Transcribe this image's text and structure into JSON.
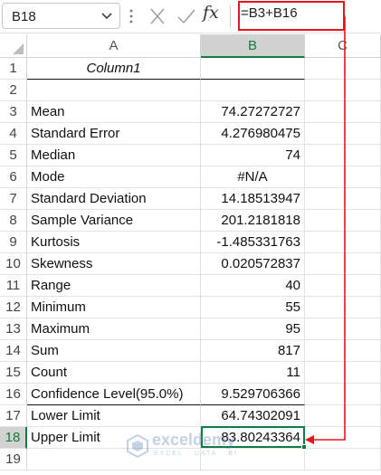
{
  "formula_bar": {
    "name_box": "B18",
    "fx_label": "fx",
    "formula": "=B3+B16"
  },
  "columns": [
    "A",
    "B",
    "C"
  ],
  "rows": [
    {
      "num": "1",
      "a": "",
      "b": "",
      "a_header": "Column1"
    },
    {
      "num": "2",
      "a": "",
      "b": ""
    },
    {
      "num": "3",
      "a": "Mean",
      "b": "74.27272727"
    },
    {
      "num": "4",
      "a": "Standard Error",
      "b": "4.276980475"
    },
    {
      "num": "5",
      "a": "Median",
      "b": "74"
    },
    {
      "num": "6",
      "a": "Mode",
      "b": "#N/A"
    },
    {
      "num": "7",
      "a": "Standard Deviation",
      "b": "14.18513947"
    },
    {
      "num": "8",
      "a": "Sample Variance",
      "b": "201.2181818"
    },
    {
      "num": "9",
      "a": "Kurtosis",
      "b": "-1.485331763"
    },
    {
      "num": "10",
      "a": "Skewness",
      "b": "0.020572837"
    },
    {
      "num": "11",
      "a": "Range",
      "b": "40"
    },
    {
      "num": "12",
      "a": "Minimum",
      "b": "55"
    },
    {
      "num": "13",
      "a": "Maximum",
      "b": "95"
    },
    {
      "num": "14",
      "a": "Sum",
      "b": "817"
    },
    {
      "num": "15",
      "a": "Count",
      "b": "11"
    },
    {
      "num": "16",
      "a": "Confidence Level(95.0%)",
      "b": "9.529706366"
    },
    {
      "num": "17",
      "a": "Lower Limit",
      "b": "64.74302091"
    },
    {
      "num": "18",
      "a": "Upper Limit",
      "b": "83.80243364"
    },
    {
      "num": "19",
      "a": "",
      "b": ""
    }
  ],
  "selected_cell": "B18",
  "watermark": {
    "text": "exceldemy",
    "sub": "EXCEL · DATA · BI"
  },
  "colors": {
    "accent": "#107c41",
    "annotation": "#e6141b"
  }
}
